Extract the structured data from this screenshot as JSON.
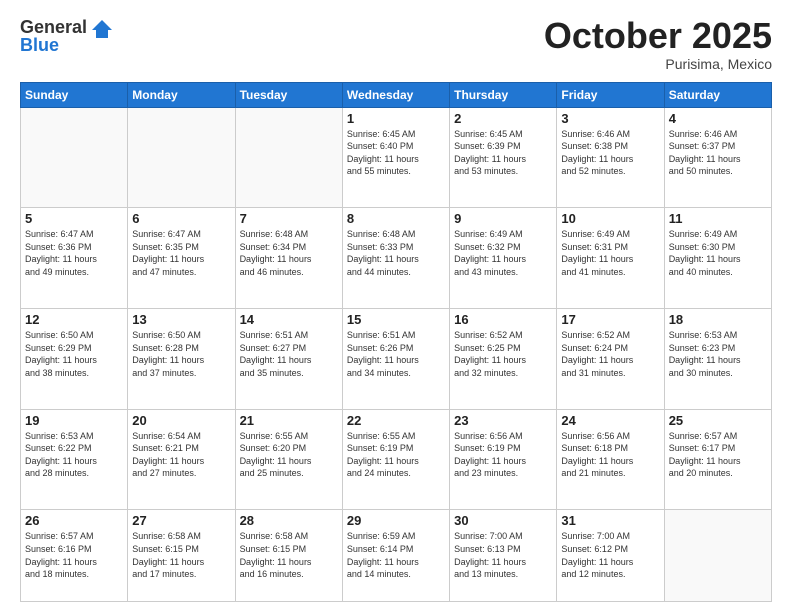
{
  "header": {
    "logo_general": "General",
    "logo_blue": "Blue",
    "month_title": "October 2025",
    "subtitle": "Purisima, Mexico"
  },
  "weekdays": [
    "Sunday",
    "Monday",
    "Tuesday",
    "Wednesday",
    "Thursday",
    "Friday",
    "Saturday"
  ],
  "weeks": [
    [
      {
        "day": "",
        "info": ""
      },
      {
        "day": "",
        "info": ""
      },
      {
        "day": "",
        "info": ""
      },
      {
        "day": "1",
        "info": "Sunrise: 6:45 AM\nSunset: 6:40 PM\nDaylight: 11 hours\nand 55 minutes."
      },
      {
        "day": "2",
        "info": "Sunrise: 6:45 AM\nSunset: 6:39 PM\nDaylight: 11 hours\nand 53 minutes."
      },
      {
        "day": "3",
        "info": "Sunrise: 6:46 AM\nSunset: 6:38 PM\nDaylight: 11 hours\nand 52 minutes."
      },
      {
        "day": "4",
        "info": "Sunrise: 6:46 AM\nSunset: 6:37 PM\nDaylight: 11 hours\nand 50 minutes."
      }
    ],
    [
      {
        "day": "5",
        "info": "Sunrise: 6:47 AM\nSunset: 6:36 PM\nDaylight: 11 hours\nand 49 minutes."
      },
      {
        "day": "6",
        "info": "Sunrise: 6:47 AM\nSunset: 6:35 PM\nDaylight: 11 hours\nand 47 minutes."
      },
      {
        "day": "7",
        "info": "Sunrise: 6:48 AM\nSunset: 6:34 PM\nDaylight: 11 hours\nand 46 minutes."
      },
      {
        "day": "8",
        "info": "Sunrise: 6:48 AM\nSunset: 6:33 PM\nDaylight: 11 hours\nand 44 minutes."
      },
      {
        "day": "9",
        "info": "Sunrise: 6:49 AM\nSunset: 6:32 PM\nDaylight: 11 hours\nand 43 minutes."
      },
      {
        "day": "10",
        "info": "Sunrise: 6:49 AM\nSunset: 6:31 PM\nDaylight: 11 hours\nand 41 minutes."
      },
      {
        "day": "11",
        "info": "Sunrise: 6:49 AM\nSunset: 6:30 PM\nDaylight: 11 hours\nand 40 minutes."
      }
    ],
    [
      {
        "day": "12",
        "info": "Sunrise: 6:50 AM\nSunset: 6:29 PM\nDaylight: 11 hours\nand 38 minutes."
      },
      {
        "day": "13",
        "info": "Sunrise: 6:50 AM\nSunset: 6:28 PM\nDaylight: 11 hours\nand 37 minutes."
      },
      {
        "day": "14",
        "info": "Sunrise: 6:51 AM\nSunset: 6:27 PM\nDaylight: 11 hours\nand 35 minutes."
      },
      {
        "day": "15",
        "info": "Sunrise: 6:51 AM\nSunset: 6:26 PM\nDaylight: 11 hours\nand 34 minutes."
      },
      {
        "day": "16",
        "info": "Sunrise: 6:52 AM\nSunset: 6:25 PM\nDaylight: 11 hours\nand 32 minutes."
      },
      {
        "day": "17",
        "info": "Sunrise: 6:52 AM\nSunset: 6:24 PM\nDaylight: 11 hours\nand 31 minutes."
      },
      {
        "day": "18",
        "info": "Sunrise: 6:53 AM\nSunset: 6:23 PM\nDaylight: 11 hours\nand 30 minutes."
      }
    ],
    [
      {
        "day": "19",
        "info": "Sunrise: 6:53 AM\nSunset: 6:22 PM\nDaylight: 11 hours\nand 28 minutes."
      },
      {
        "day": "20",
        "info": "Sunrise: 6:54 AM\nSunset: 6:21 PM\nDaylight: 11 hours\nand 27 minutes."
      },
      {
        "day": "21",
        "info": "Sunrise: 6:55 AM\nSunset: 6:20 PM\nDaylight: 11 hours\nand 25 minutes."
      },
      {
        "day": "22",
        "info": "Sunrise: 6:55 AM\nSunset: 6:19 PM\nDaylight: 11 hours\nand 24 minutes."
      },
      {
        "day": "23",
        "info": "Sunrise: 6:56 AM\nSunset: 6:19 PM\nDaylight: 11 hours\nand 23 minutes."
      },
      {
        "day": "24",
        "info": "Sunrise: 6:56 AM\nSunset: 6:18 PM\nDaylight: 11 hours\nand 21 minutes."
      },
      {
        "day": "25",
        "info": "Sunrise: 6:57 AM\nSunset: 6:17 PM\nDaylight: 11 hours\nand 20 minutes."
      }
    ],
    [
      {
        "day": "26",
        "info": "Sunrise: 6:57 AM\nSunset: 6:16 PM\nDaylight: 11 hours\nand 18 minutes."
      },
      {
        "day": "27",
        "info": "Sunrise: 6:58 AM\nSunset: 6:15 PM\nDaylight: 11 hours\nand 17 minutes."
      },
      {
        "day": "28",
        "info": "Sunrise: 6:58 AM\nSunset: 6:15 PM\nDaylight: 11 hours\nand 16 minutes."
      },
      {
        "day": "29",
        "info": "Sunrise: 6:59 AM\nSunset: 6:14 PM\nDaylight: 11 hours\nand 14 minutes."
      },
      {
        "day": "30",
        "info": "Sunrise: 7:00 AM\nSunset: 6:13 PM\nDaylight: 11 hours\nand 13 minutes."
      },
      {
        "day": "31",
        "info": "Sunrise: 7:00 AM\nSunset: 6:12 PM\nDaylight: 11 hours\nand 12 minutes."
      },
      {
        "day": "",
        "info": ""
      }
    ]
  ]
}
